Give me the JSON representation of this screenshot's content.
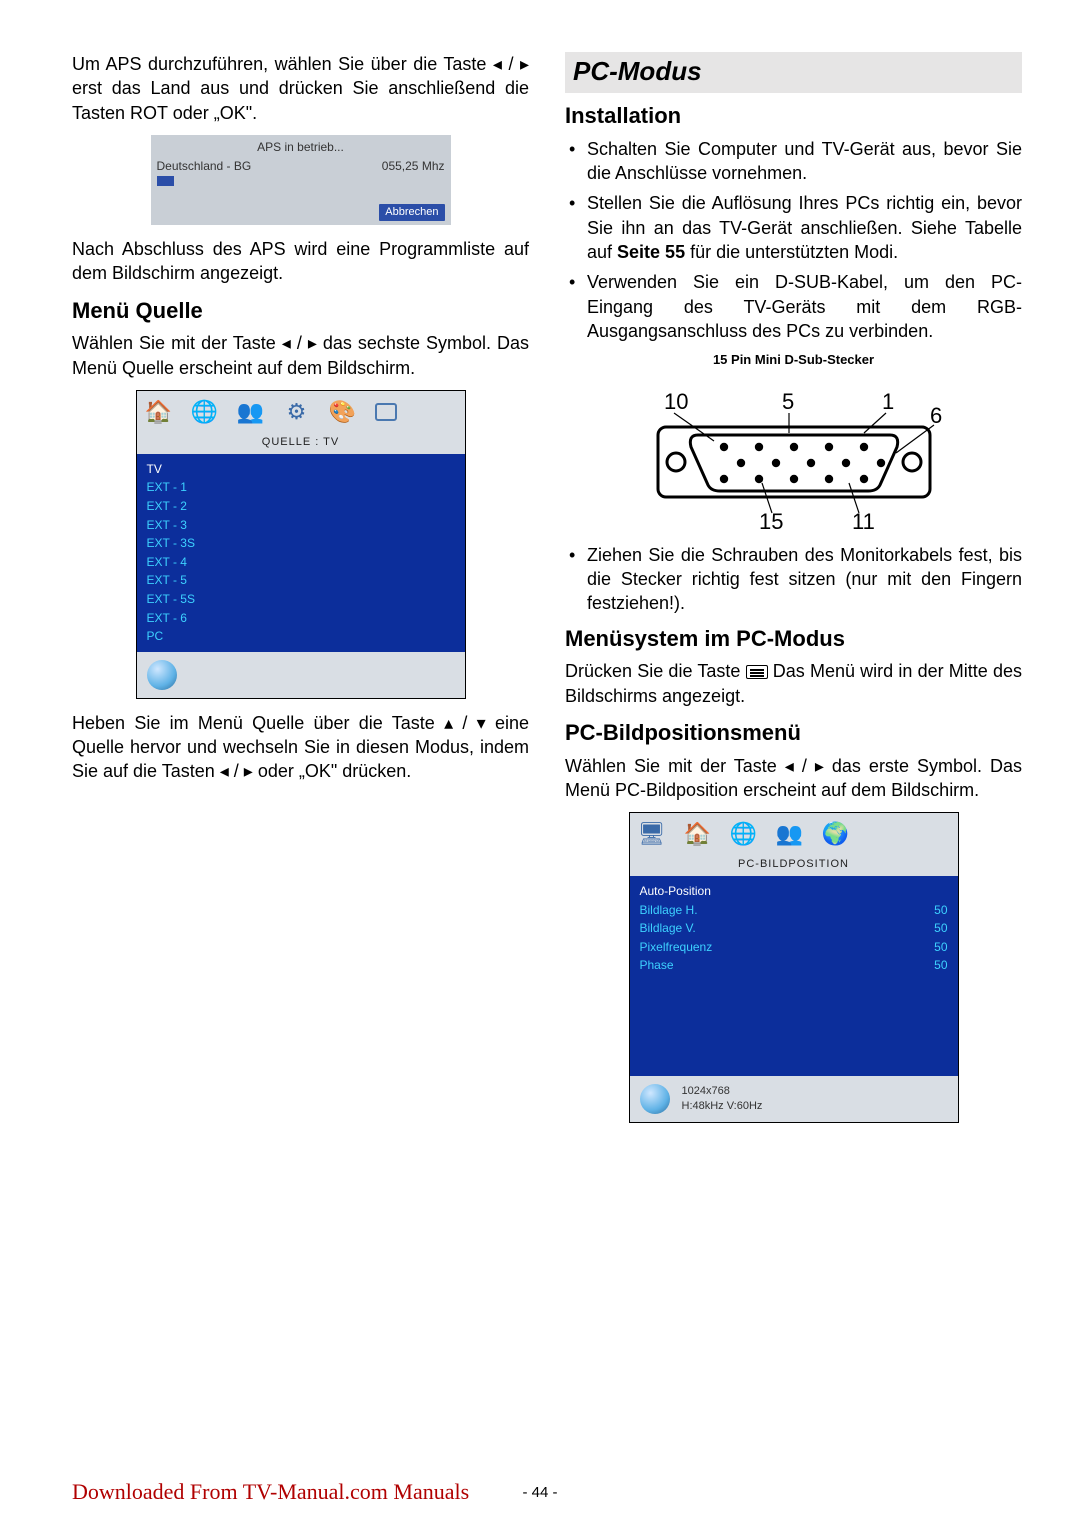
{
  "left": {
    "intro": "Um APS durchzuführen, wählen Sie über die Taste ◂ / ▸ erst das Land aus und drücken Sie anschließend die Tasten ROT oder „OK\".",
    "aps": {
      "status": "APS in betrieb...",
      "country": "Deutschland - BG",
      "freq": "055,25  Mhz",
      "cancel": "Abbrechen"
    },
    "after_aps": "Nach Abschluss des APS wird eine Programmliste auf dem Bildschirm angezeigt.",
    "menu_quelle_heading": "Menü Quelle",
    "quelle_intro": "Wählen Sie mit der Taste ◂ / ▸ das sechste Symbol. Das Menü Quelle erscheint auf dem Bildschirm.",
    "quelle_menu": {
      "title": "QUELLE  :  TV",
      "items": [
        "TV",
        "EXT - 1",
        "EXT - 2",
        "EXT - 3",
        "EXT - 3S",
        "EXT - 4",
        "EXT - 5",
        "EXT - 5S",
        "EXT - 6",
        "PC"
      ]
    },
    "quelle_after": "Heben Sie im Menü Quelle über die Taste ▴ / ▾ eine Quelle hervor und wechseln Sie in diesen Modus, indem Sie auf die Tasten ◂ / ▸ oder „OK\" drücken."
  },
  "right": {
    "pc_modus_heading": "PC-Modus",
    "installation_heading": "Installation",
    "install_bullets": [
      "Schalten Sie Computer und TV-Gerät aus, bevor Sie die Anschlüsse vornehmen.",
      "Stellen Sie die Auflösung Ihres PCs richtig ein, bevor Sie ihn an das TV-Gerät anschließen. Siehe Tabelle auf Seite 55 für die unterstützten Modi.",
      "Verwenden Sie ein D-SUB-Kabel, um den PC-Eingang des TV-Geräts mit dem RGB-Ausgangsanschluss des PCs zu verbinden."
    ],
    "dsub_caption": "15 Pin Mini D-Sub-Stecker",
    "dsub_labels": {
      "tl": "10",
      "tc": "5",
      "tr1": "1",
      "tr2": "6",
      "bl": "15",
      "br": "11"
    },
    "tighten_bullet": "Ziehen Sie die Schrauben des Monitorkabels fest, bis die Stecker richtig fest sitzen (nur mit den Fingern festziehen!).",
    "menusystem_heading": "Menüsystem im PC-Modus",
    "menusystem_text_a": "Drücken Sie die Taste ",
    "menusystem_text_b": " Das Menü wird in der Mitte des Bildschirms angezeigt.",
    "pc_bildpos_heading": "PC-Bildpositionsmenü",
    "pc_bildpos_intro": "Wählen Sie mit der Taste ◂ / ▸ das erste Symbol. Das Menü PC-Bildposition erscheint auf dem Bildschirm.",
    "pc_bildpos_menu": {
      "title": "PC-BILDPOSITION",
      "rows": [
        {
          "label": "Auto-Position"
        },
        {
          "label": "Bildlage H.",
          "value": "50"
        },
        {
          "label": "Bildlage V.",
          "value": "50"
        },
        {
          "label": "Pixelfrequenz",
          "value": "50"
        },
        {
          "label": "Phase",
          "value": "50"
        }
      ],
      "footer_line1": "1024x768",
      "footer_line2": "H:48kHz  V:60Hz"
    }
  },
  "footer": {
    "download_note": "Downloaded From TV-Manual.com Manuals",
    "page_number": "- 44 -"
  }
}
